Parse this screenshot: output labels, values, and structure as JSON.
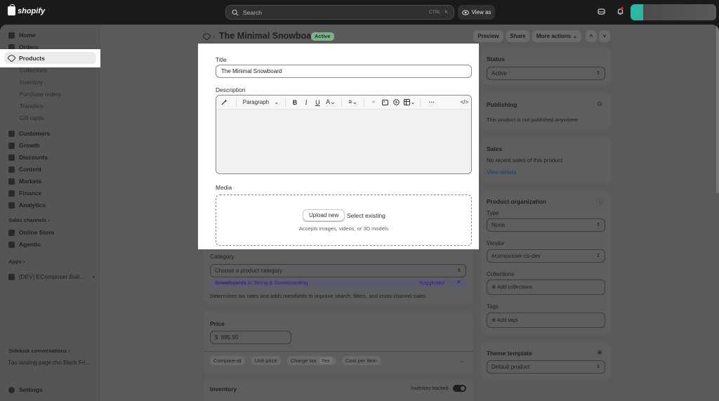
{
  "topbar": {
    "logo_text": "shopify",
    "search_placeholder": "Search",
    "search_shortcut_1": "CTRL",
    "search_shortcut_2": "K",
    "view_as_label": "View as"
  },
  "sidebar": {
    "items": [
      {
        "label": "Home"
      },
      {
        "label": "Orders"
      },
      {
        "label": "Products"
      }
    ],
    "product_subitems": [
      "Collections",
      "Inventory",
      "Purchase orders",
      "Transfers",
      "Gift cards"
    ],
    "more_items": [
      "Customers",
      "Growth",
      "Discounts",
      "Content",
      "Markets",
      "Finance",
      "Analytics"
    ],
    "sales_channels_label": "Sales channels",
    "sales_channels": [
      "Online Store",
      "Agentic"
    ],
    "apps_label": "Apps",
    "app_item": "[DEV] EComposer Buil...",
    "sidekick_label": "Sidekick conversations",
    "sidekick_item": "Tạo landing page cho Black Fri...",
    "settings_label": "Settings"
  },
  "header": {
    "title": "The Minimal Snowboard",
    "status_badge": "Active",
    "preview_label": "Preview",
    "share_label": "Share",
    "more_actions_label": "More actions"
  },
  "product_form": {
    "title_label": "Title",
    "title_value": "The Minimal Snowboard",
    "description_label": "Description",
    "paragraph_label": "Paragraph",
    "media_label": "Media",
    "upload_new_label": "Upload new",
    "select_existing_label": "Select existing",
    "media_hint": "Accepts images, videos, or 3D models",
    "category_label": "Category",
    "category_placeholder": "Choose a product category",
    "suggestion_prefix": "Snowboards",
    "suggestion_mid": " in Skiing & Snowboarding",
    "suggested_label": "Suggested",
    "category_hint": "Determines tax rates and adds metafields to improve search, filters, and cross-channel sales",
    "price_label": "Price",
    "currency_symbol": "$",
    "price_value": "885.95",
    "compare_at_label": "Compare-at",
    "unit_price_label": "Unit price",
    "charge_tax_label": "Charge tax",
    "charge_tax_value": "Yes",
    "cost_per_item_label": "Cost per item",
    "inventory_label": "Inventory",
    "inventory_tracked_label": "Inventory tracked"
  },
  "right_panel": {
    "status_label": "Status",
    "status_value": "Active",
    "publishing_label": "Publishing",
    "publishing_text": "This product is not published anywhere",
    "sales_label": "Sales",
    "sales_text": "No recent sales of this product",
    "view_details_label": "View details",
    "org_label": "Product organization",
    "type_label": "Type",
    "type_value": "None",
    "vendor_label": "Vendor",
    "vendor_value": "ecomposser-cs-dev",
    "collections_label": "Collections",
    "add_collections_label": "Add collections",
    "tags_label": "Tags",
    "add_tags_label": "Add tags",
    "theme_template_label": "Theme template",
    "theme_template_value": "Default product"
  },
  "colors": {
    "accent_link": "#2c6ecb",
    "suggestion_purple": "#5c2ab3",
    "active_badge": "#7db28a"
  }
}
